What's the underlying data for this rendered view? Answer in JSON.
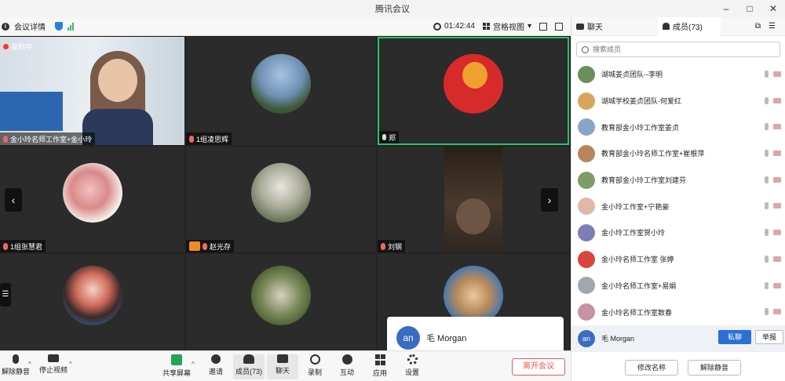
{
  "window": {
    "title": "腾讯会议"
  },
  "topbar": {
    "meeting_details": "会议详情",
    "timer": "01:42:44",
    "view_mode": "宫格视图"
  },
  "recording_label": "录制中",
  "tiles": [
    {
      "name": "金小玲名师工作室+金小玲",
      "muted": true
    },
    {
      "name": "1组凌思辉",
      "muted": true
    },
    {
      "name": "郑",
      "muted": false,
      "active": true
    },
    {
      "name": "1组张慧君",
      "muted": true
    },
    {
      "name": "赵光存",
      "muted": true
    },
    {
      "name": "刘钢",
      "muted": false
    }
  ],
  "popup": {
    "initials": "an",
    "name": "毛 Morgan"
  },
  "toolbar": {
    "unmute": "解除静音",
    "stop_video": "停止视频",
    "share_screen": "共享屏幕",
    "invite": "邀请",
    "members": "成员(73)",
    "chat": "聊天",
    "record": "录制",
    "interact": "互动",
    "apps": "应用",
    "settings": "设置",
    "leave": "离开会议"
  },
  "side": {
    "tab_chat": "聊天",
    "tab_members": "成员(73)",
    "search_placeholder": "搜索成员",
    "members": [
      {
        "name": "湖城姜贞团队--李明",
        "color": "#6b8e5a"
      },
      {
        "name": "湖城学校姜贞团队-何爱红",
        "color": "#d9a55b"
      },
      {
        "name": "教育部金小玲工作室姜贞",
        "color": "#8aa4c8"
      },
      {
        "name": "教育部金小玲名师工作室+崔根萍",
        "color": "#b7855c"
      },
      {
        "name": "教育部金小玲工作室刘建芬",
        "color": "#7f9b6a"
      },
      {
        "name": "金小玲工作室+宁艳豪",
        "color": "#e0b8a8"
      },
      {
        "name": "金小玲工作室贺小玲",
        "color": "#7c7fb5"
      },
      {
        "name": "金小玲名师工作室 张婷",
        "color": "#d8473f"
      },
      {
        "name": "金小玲名师工作室+易娟",
        "color": "#a0a7ad"
      },
      {
        "name": "金小玲名师工作室数春",
        "color": "#c892a5"
      }
    ],
    "hovered_member": {
      "initials": "an",
      "name": "毛 Morgan"
    },
    "private_chat": "私聊",
    "report": "举报",
    "rename": "修改名称",
    "unmute": "解除静音"
  }
}
